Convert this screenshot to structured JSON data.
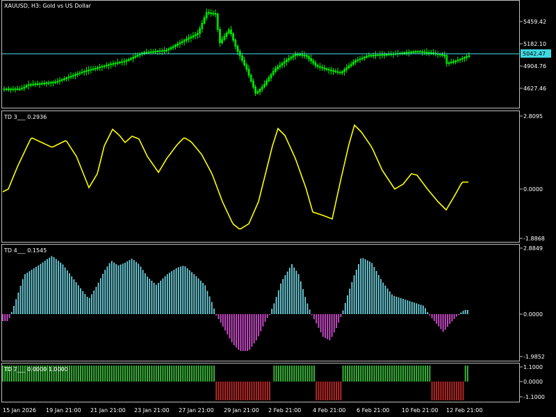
{
  "colors": {
    "background": "#000000",
    "frame": "#c0c0c0",
    "grid": "#3a3a3a",
    "candle": "#00ff00",
    "price_line": "#3fd8e0",
    "price_badge": "#3fd8e0",
    "td3_line": "#ffff00",
    "td4_pos": "#6fd3e0",
    "td4_neg": "#d24fd2",
    "td7_up": "#3ec23e",
    "td7_down": "#c42a2a"
  },
  "main": {
    "title": "XAUUSD, H3:  Gold vs US Dollar",
    "ticks": [
      "5459.42",
      "5182.10",
      "4904.76",
      "4627.46"
    ],
    "current_price": "5042.47"
  },
  "td3": {
    "title": "TD 3___  0.2936",
    "ticks": [
      "2.8095",
      "0.0000",
      "-1.8868"
    ]
  },
  "td4": {
    "title": "TD 4___  0.1545",
    "ticks": [
      "2.8849",
      "0.0000",
      "-1.9852"
    ]
  },
  "td7": {
    "title": "TD 7___  0.0000  1.0000",
    "ticks": [
      "1.1000",
      "0.0000",
      "-1.1000"
    ]
  },
  "time_axis": [
    "15 Jan 2026",
    "19 Jan 21:00",
    "21 Jan 21:00",
    "23 Jan 21:00",
    "27 Jan 21:00",
    "29 Jan 21:00",
    "2 Feb 21:00",
    "4 Feb 21:00",
    "6 Feb 21:00",
    "10 Feb 21:00",
    "12 Feb 21:00"
  ]
}
